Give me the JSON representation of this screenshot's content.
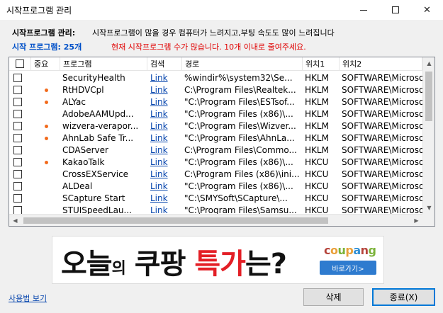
{
  "window": {
    "title": "시작프로그램 관리",
    "min_icon": "minimize-icon",
    "max_icon": "maximize-icon",
    "close_icon": "close-icon"
  },
  "info": {
    "label": "시작프로그램 관리:",
    "message": "시작프로그램이 많을 경우 컴퓨터가 느려지고,부팅 속도도 많이 느려집니다",
    "count_text": "시작 프로그램: 25개",
    "warning": "현재 시작프로그램 수가 많습니다. 10개 이내로 줄여주세요."
  },
  "table": {
    "columns": [
      "",
      "중요",
      "프로그램",
      "검색",
      "경로",
      "위치1",
      "위치2"
    ],
    "rows": [
      {
        "checked": false,
        "important": false,
        "program": "SecurityHealth",
        "search": "Link",
        "path": "%windir%\\system32\\Se...",
        "loc1": "HKLM",
        "loc2": "SOFTWARE\\Microso"
      },
      {
        "checked": false,
        "important": true,
        "program": "RtHDVCpl",
        "search": "Link",
        "path": "C:\\Program Files\\Realtek...",
        "loc1": "HKLM",
        "loc2": "SOFTWARE\\Microso"
      },
      {
        "checked": false,
        "important": true,
        "program": "ALYac",
        "search": "Link",
        "path": "\"C:\\Program Files\\ESTsof...",
        "loc1": "HKLM",
        "loc2": "SOFTWARE\\Microso"
      },
      {
        "checked": false,
        "important": false,
        "program": "AdobeAAMUpd...",
        "search": "Link",
        "path": "\"C:\\Program Files (x86)\\...",
        "loc1": "HKLM",
        "loc2": "SOFTWARE\\Microso"
      },
      {
        "checked": false,
        "important": true,
        "program": "wizvera-verapor...",
        "search": "Link",
        "path": "\"C:\\Program Files\\Wizver...",
        "loc1": "HKLM",
        "loc2": "SOFTWARE\\Microso"
      },
      {
        "checked": false,
        "important": true,
        "program": "AhnLab Safe Tr...",
        "search": "Link",
        "path": "\"C:\\Program Files\\AhnLa...",
        "loc1": "HKLM",
        "loc2": "SOFTWARE\\Microso"
      },
      {
        "checked": false,
        "important": false,
        "program": "CDAServer",
        "search": "Link",
        "path": "C:\\Program Files\\Commo...",
        "loc1": "HKLM",
        "loc2": "SOFTWARE\\Microso"
      },
      {
        "checked": false,
        "important": true,
        "program": "KakaoTalk",
        "search": "Link",
        "path": "\"C:\\Program Files (x86)\\...",
        "loc1": "HKCU",
        "loc2": "SOFTWARE\\Microso"
      },
      {
        "checked": false,
        "important": false,
        "program": "CrossEXService",
        "search": "Link",
        "path": "C:\\Program Files (x86)\\ini...",
        "loc1": "HKCU",
        "loc2": "SOFTWARE\\Microso"
      },
      {
        "checked": false,
        "important": false,
        "program": "ALDeal",
        "search": "Link",
        "path": "\"C:\\Program Files (x86)\\...",
        "loc1": "HKCU",
        "loc2": "SOFTWARE\\Microso"
      },
      {
        "checked": false,
        "important": false,
        "program": "SCapture Start",
        "search": "Link",
        "path": "\"C:\\SMYSoft\\SCapture\\...",
        "loc1": "HKCU",
        "loc2": "SOFTWARE\\Microso"
      },
      {
        "checked": false,
        "important": false,
        "program": "STUISpeedLau...",
        "search": "Link",
        "path": "\"C:\\Program Files\\Samsu...",
        "loc1": "HKCU",
        "loc2": "SOFTWARE\\Microso"
      }
    ]
  },
  "ad": {
    "main_a": "오늘",
    "main_b": "의",
    "main_c": "쿠팡 ",
    "main_d": "특가",
    "main_e": "는?",
    "brand": [
      "c",
      "o",
      "u",
      "p",
      "a",
      "n",
      "g"
    ],
    "button": "바로가기>"
  },
  "footer": {
    "help": "사용법 보기",
    "delete": "삭제",
    "exit": "종료(X)"
  },
  "colors": {
    "accent_blue": "#0050c8",
    "warning_red": "#e00000",
    "dot_orange": "#f26b1d",
    "link": "#0645ad"
  }
}
